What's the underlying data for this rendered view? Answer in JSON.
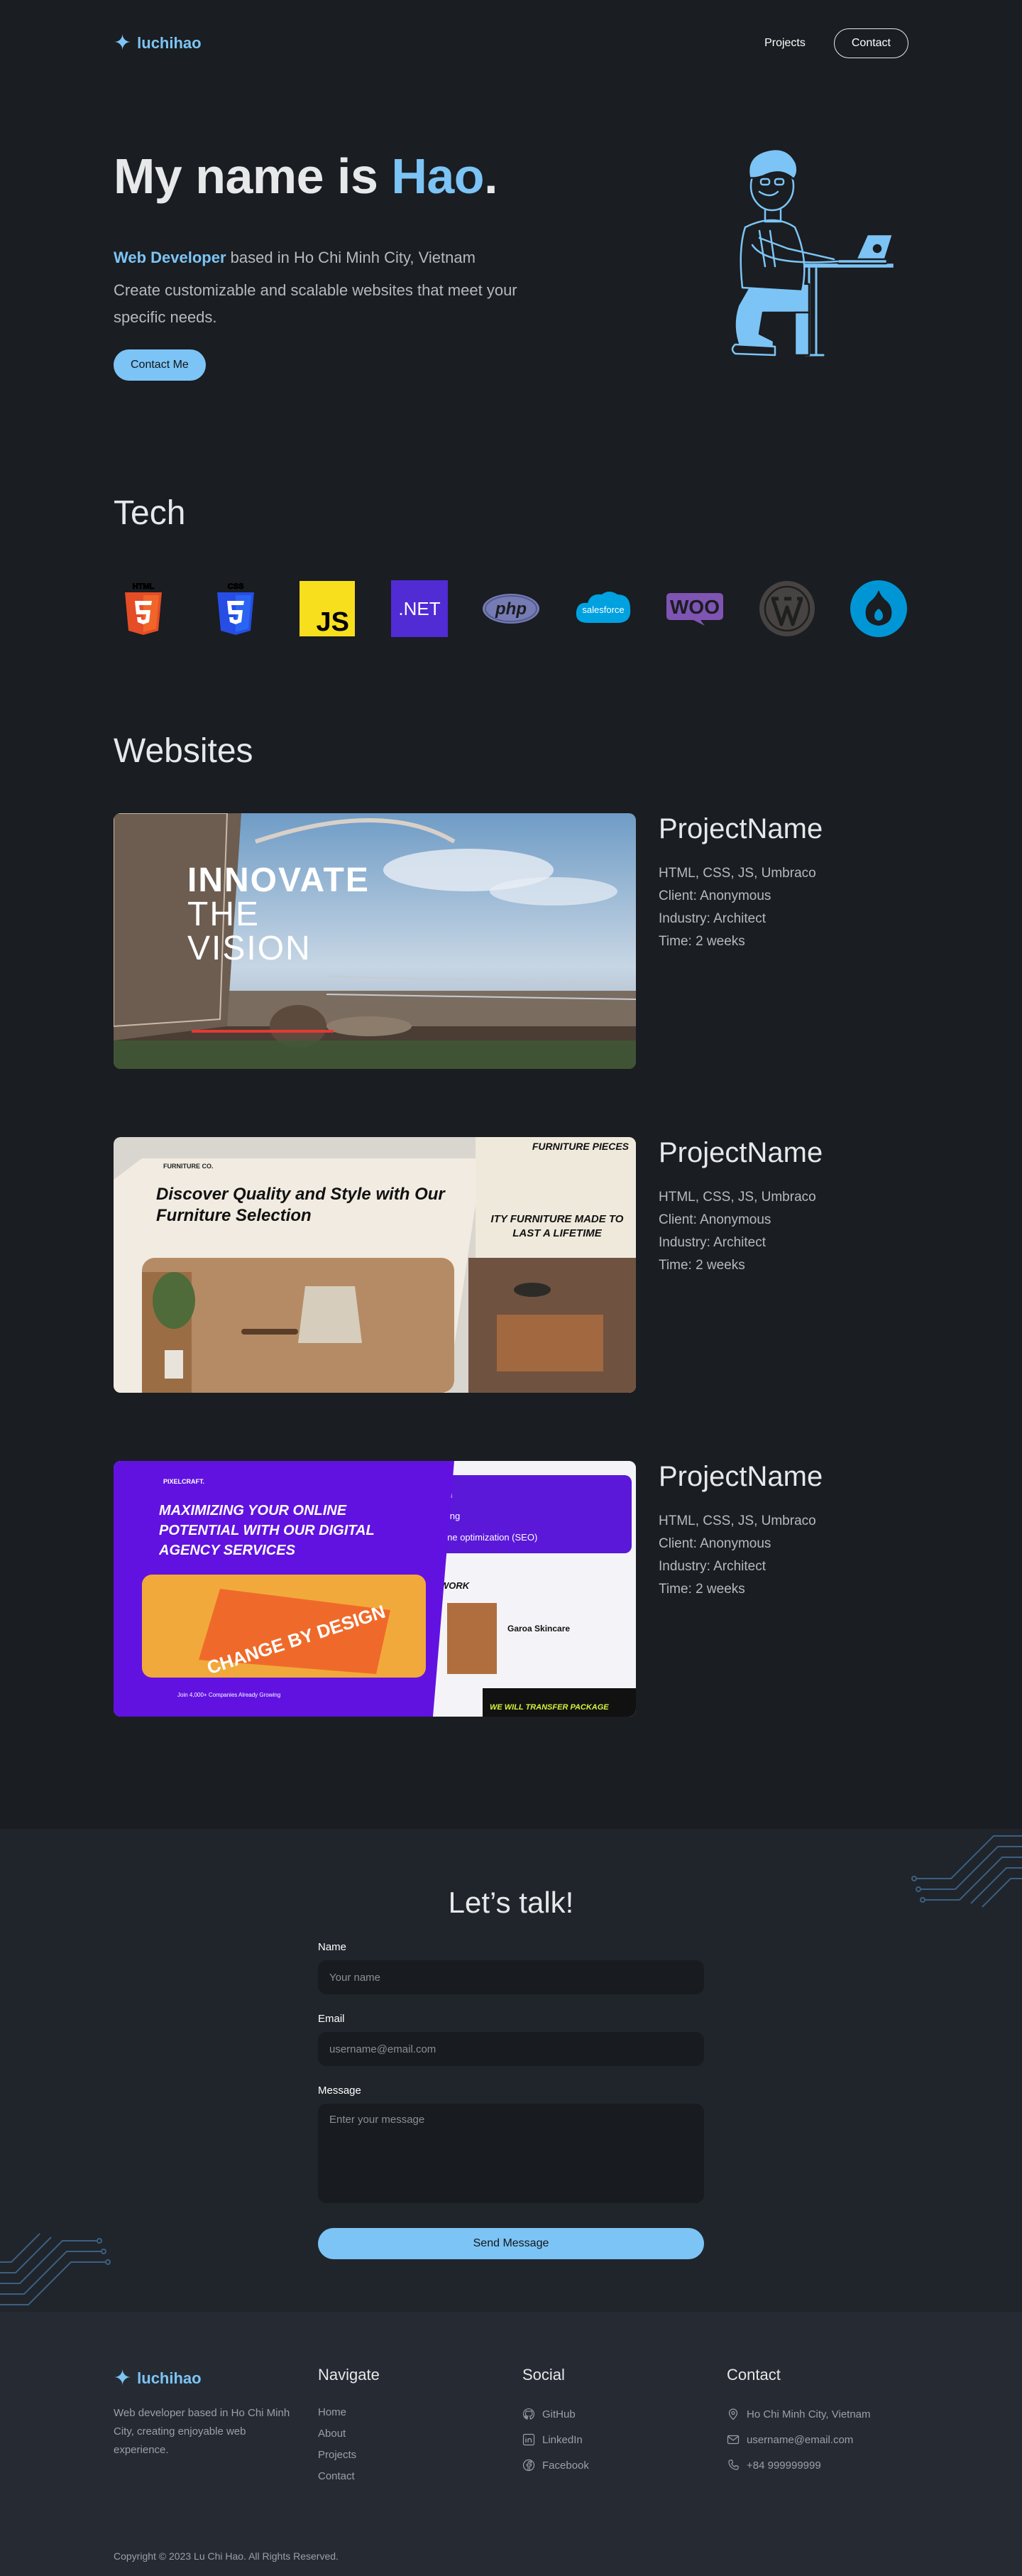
{
  "header": {
    "logo_glyph": "✦",
    "logo_text": "luchihao",
    "nav_projects": "Projects",
    "nav_contact": "Contact"
  },
  "hero": {
    "title_prefix": "My name is ",
    "title_name": "Hao",
    "title_suffix": ".",
    "role": "Web Developer",
    "location_text": " based in Ho Chi Minh City, Vietnam",
    "description": "Create customizable and scalable websites that meet your specific needs.",
    "cta": "Contact Me",
    "illustration_icon": "developer-at-laptop-illustration"
  },
  "tech": {
    "title": "Tech",
    "items": [
      {
        "name": "HTML",
        "icon": "html5-icon",
        "color": "#e44d26"
      },
      {
        "name": "CSS",
        "icon": "css3-icon",
        "color": "#2965f1"
      },
      {
        "name": "JS",
        "icon": "javascript-icon",
        "color": "#f7df1e"
      },
      {
        "name": ".NET",
        "icon": "dotnet-icon",
        "color": "#512bd4"
      },
      {
        "name": "php",
        "icon": "php-icon",
        "color": "#777bb3"
      },
      {
        "name": "salesforce",
        "icon": "salesforce-icon",
        "color": "#00a1e0"
      },
      {
        "name": "WOO",
        "icon": "woocommerce-icon",
        "color": "#7f54b3"
      },
      {
        "name": "WordPress",
        "icon": "wordpress-icon",
        "color": "#464342"
      },
      {
        "name": "Drupal",
        "icon": "drupal-icon",
        "color": "#0096d6"
      }
    ]
  },
  "websites": {
    "title": "Websites",
    "projects": [
      {
        "name": "ProjectName",
        "stack": "HTML, CSS, JS, Umbraco",
        "client": "Client: Anonymous",
        "industry": "Industry: Architect",
        "time": "Time: 2 weeks",
        "thumb": {
          "l1": "INNOVATE",
          "l2": "THE",
          "l3": "VISION"
        }
      },
      {
        "name": "ProjectName",
        "stack": "HTML, CSS, JS, Umbraco",
        "client": "Client: Anonymous",
        "industry": "Industry: Architect",
        "time": "Time: 2 weeks",
        "thumb": {
          "brand": "FURNITURE CO.",
          "headline": "Discover Quality and Style with Our Furniture Selection",
          "side_title": "FURNITURE PIECES",
          "side_headline": "ITY FURNITURE MADE TO LAST A LIFETIME"
        }
      },
      {
        "name": "ProjectName",
        "stack": "HTML, CSS, JS, Umbraco",
        "client": "Client: Anonymous",
        "industry": "Industry: Architect",
        "time": "Time: 2 weeks",
        "thumb": {
          "brand": "PIXELCRAFT.",
          "headline": "MAXIMIZING YOUR ONLINE POTENTIAL WITH OUR DIGITAL AGENCY SERVICES",
          "book": "CHANGE BY DESIGN",
          "side_1": "ign",
          "side_2": "eting",
          "side_3": "gine optimization (SEO)",
          "side_work": "WORK",
          "side_brand": "Garoa Skincare",
          "side_footer": "WE WILL TRANSFER PACKAGE",
          "partners": "Join 4,000+ Companies Already Growing"
        }
      }
    ]
  },
  "contact": {
    "title": "Let’s talk!",
    "name_label": "Name",
    "name_placeholder": "Your name",
    "email_label": "Email",
    "email_placeholder": "username@email.com",
    "message_label": "Message",
    "message_placeholder": "Enter your message",
    "submit": "Send Message"
  },
  "footer": {
    "logo_glyph": "✦",
    "logo_text": "luchihao",
    "description": "Web developer based in Ho Chi Minh City, creating enjoyable web experience.",
    "navigate_title": "Navigate",
    "navigate": [
      "Home",
      "About",
      "Projects",
      "Contact"
    ],
    "social_title": "Social",
    "social": [
      {
        "label": "GitHub",
        "icon": "github-icon"
      },
      {
        "label": "LinkedIn",
        "icon": "linkedin-icon"
      },
      {
        "label": "Facebook",
        "icon": "facebook-icon"
      }
    ],
    "contact_title": "Contact",
    "contact": [
      {
        "label": "Ho Chi Minh City, Vietnam",
        "icon": "location-pin-icon"
      },
      {
        "label": "username@email.com",
        "icon": "mail-icon"
      },
      {
        "label": "+84 999999999",
        "icon": "phone-icon"
      }
    ],
    "copyright": "Copyright © 2023 Lu Chi Hao. All Rights Reserved."
  },
  "colors": {
    "background": "#1a1d21",
    "contact_bg": "#20252b",
    "footer_bg": "#262b33",
    "accent": "#7cc4f5",
    "text": "#e6e8ea",
    "muted": "#b6babf"
  }
}
